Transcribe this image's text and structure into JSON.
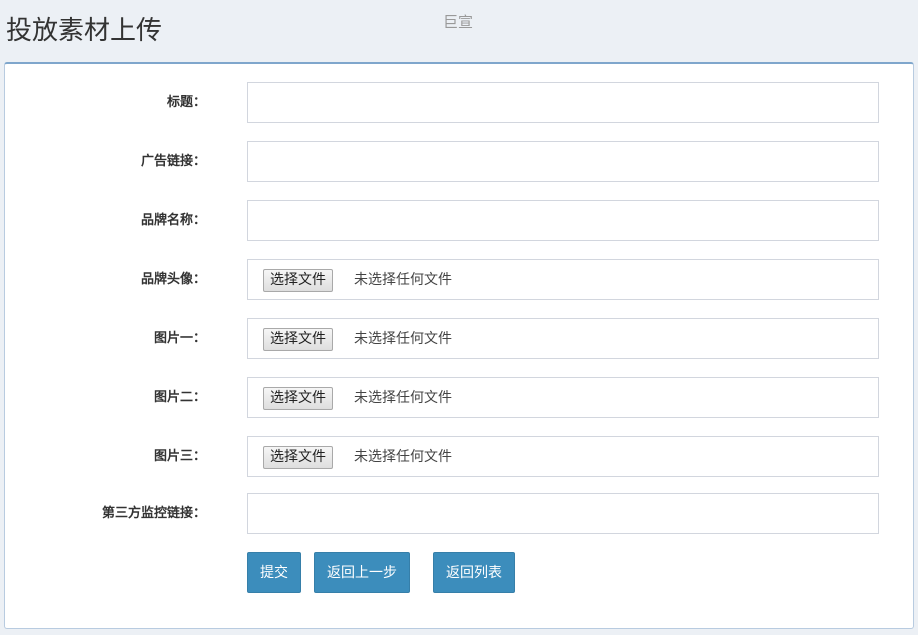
{
  "header": {
    "title": "投放素材上传",
    "subtitle": "巨宣"
  },
  "form": {
    "fields": [
      {
        "label": "标题：",
        "type": "text",
        "value": ""
      },
      {
        "label": "广告链接：",
        "type": "text",
        "value": ""
      },
      {
        "label": "品牌名称：",
        "type": "text",
        "value": ""
      },
      {
        "label": "品牌头像：",
        "type": "file",
        "button": "选择文件",
        "status": "未选择任何文件"
      },
      {
        "label": "图片一：",
        "type": "file",
        "button": "选择文件",
        "status": "未选择任何文件"
      },
      {
        "label": "图片二：",
        "type": "file",
        "button": "选择文件",
        "status": "未选择任何文件"
      },
      {
        "label": "图片三：",
        "type": "file",
        "button": "选择文件",
        "status": "未选择任何文件"
      },
      {
        "label": "第三方监控链接：",
        "type": "text",
        "value": ""
      }
    ],
    "buttons": {
      "submit": "提交",
      "back": "返回上一步",
      "list": "返回列表"
    }
  },
  "colors": {
    "primary": "#3c8dbc",
    "background": "#ecf0f5",
    "box_border": "#7fa6cc"
  }
}
